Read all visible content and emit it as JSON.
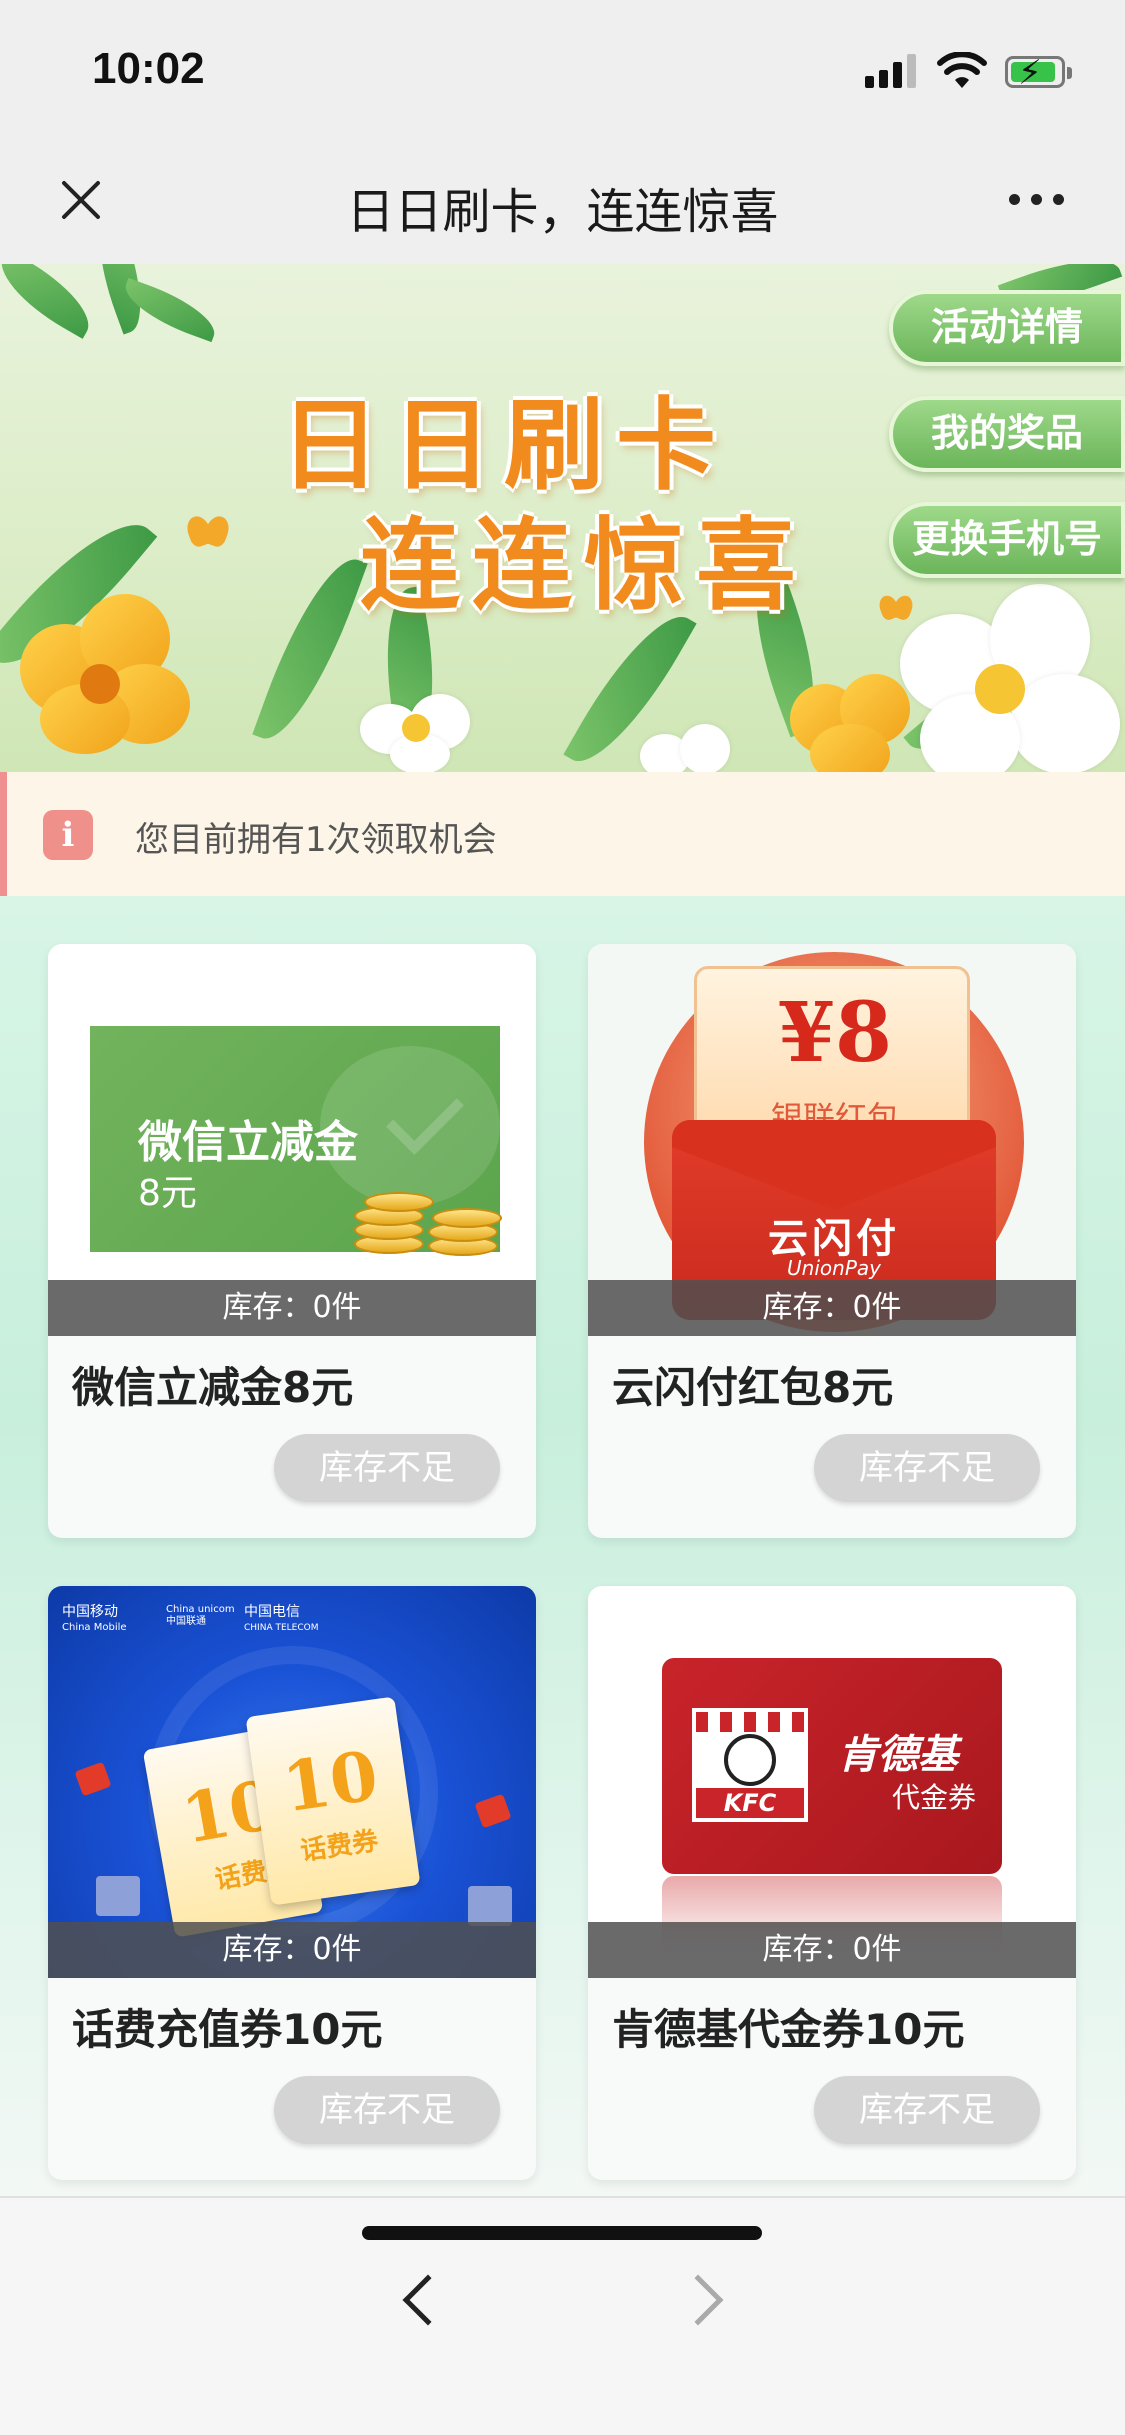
{
  "status_bar": {
    "time": "10:02"
  },
  "nav": {
    "title": "日日刷卡，连连惊喜"
  },
  "banner": {
    "title_line1": "日日刷卡",
    "title_line2": "连连惊喜",
    "buttons": [
      "活动详情",
      "我的奖品",
      "更换手机号"
    ]
  },
  "notice": {
    "icon": "i",
    "text": "您目前拥有1次领取机会"
  },
  "prizes": [
    {
      "title": "微信立减金8元",
      "stock": "库存：0件",
      "button": "库存不足",
      "image": {
        "line1": "微信立减金",
        "line2": "8元"
      }
    },
    {
      "title": "云闪付红包8元",
      "stock": "库存：0件",
      "button": "库存不足",
      "image": {
        "amount": "¥8",
        "label": "银联红包",
        "brand": "云闪付",
        "brand_en": "UnionPay"
      }
    },
    {
      "title": "话费充值券10元",
      "stock": "库存：0件",
      "button": "库存不足",
      "image": {
        "logo_mobile": "中国移动",
        "logo_mobile_en": "China Mobile",
        "logo_unicom": "China unicom中国联通",
        "logo_telecom": "中国电信",
        "logo_telecom_en": "CHINA TELECOM",
        "ticket_num": "10",
        "ticket_label": "话费券",
        "ticket_back_label": "话费"
      }
    },
    {
      "title": "肯德基代金券10元",
      "stock": "库存：0件",
      "button": "库存不足",
      "image": {
        "logo_word": "KFC",
        "name": "肯德基",
        "sub": "代金券"
      }
    }
  ],
  "colors": {
    "accent_green": "#6bb55a",
    "banner_title": "#f28b1e",
    "notice_icon": "#f0908a",
    "disabled_button": "#d4d4d4"
  },
  "icons": {
    "close": "close-icon",
    "more": "more-icon",
    "info": "info-icon",
    "back": "chevron-left-icon",
    "forward": "chevron-right-icon"
  }
}
